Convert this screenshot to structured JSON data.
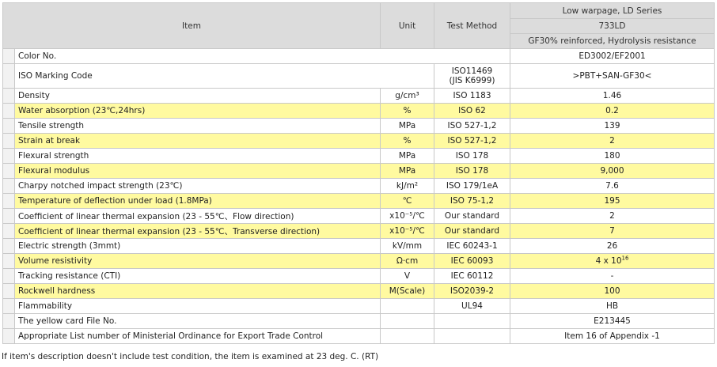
{
  "header": {
    "item": "Item",
    "unit": "Unit",
    "method": "Test Method",
    "series": "Low warpage, LD Series",
    "grade": "733LD",
    "desc": "GF30% reinforced, Hydrolysis resistance"
  },
  "rows": [
    {
      "item": "Color No.",
      "unit": "",
      "method": "",
      "value": "ED3002/EF2001",
      "hl": false,
      "merge": "item"
    },
    {
      "item": "ISO Marking Code",
      "unit": "",
      "method": "ISO11469",
      "method2": "(JIS K6999)",
      "value": ">PBT+SAN-GF30<",
      "hl": false,
      "merge": "unit"
    },
    {
      "item": "Density",
      "unit": "g/cm³",
      "method": "ISO 1183",
      "value": "1.46",
      "hl": false
    },
    {
      "item": "Water absorption (23℃,24hrs)",
      "unit": "%",
      "method": "ISO 62",
      "value": "0.2",
      "hl": true
    },
    {
      "item": "Tensile strength",
      "unit": "MPa",
      "method": "ISO 527-1,2",
      "value": "139",
      "hl": false
    },
    {
      "item": "Strain at break",
      "unit": "%",
      "method": "ISO 527-1,2",
      "value": "2",
      "hl": true
    },
    {
      "item": "Flexural strength",
      "unit": "MPa",
      "method": "ISO 178",
      "value": "180",
      "hl": false
    },
    {
      "item": "Flexural modulus",
      "unit": "MPa",
      "method": "ISO 178",
      "value": "9,000",
      "hl": true
    },
    {
      "item": "Charpy notched impact strength (23℃)",
      "unit": "kJ/m²",
      "method": "ISO 179/1eA",
      "value": "7.6",
      "hl": false
    },
    {
      "item": "Temperature of deflection under load (1.8MPa)",
      "unit": "℃",
      "method": "ISO 75-1,2",
      "value": "195",
      "hl": true
    },
    {
      "item": "Coefficient of linear thermal expansion (23 - 55℃、Flow direction)",
      "unit": "x10⁻⁵/℃",
      "method": "Our standard",
      "value": "2",
      "hl": false
    },
    {
      "item": "Coefficient of linear thermal expansion (23 - 55℃、Transverse direction)",
      "unit": "x10⁻⁵/℃",
      "method": "Our standard",
      "value": "7",
      "hl": true
    },
    {
      "item": "Electric strength (3mmt)",
      "unit": "kV/mm",
      "method": "IEC 60243-1",
      "value": "26",
      "hl": false
    },
    {
      "item": "Volume resistivity",
      "unit": "Ω·cm",
      "method": "IEC 60093",
      "value": "4 x 10",
      "sup": "16",
      "hl": true
    },
    {
      "item": "Tracking resistance (CTI)",
      "unit": "V",
      "method": "IEC 60112",
      "value": "-",
      "hl": false
    },
    {
      "item": "Rockwell hardness",
      "unit": "M(Scale)",
      "method": "ISO2039-2",
      "value": "100",
      "hl": true
    },
    {
      "item": "Flammability",
      "unit": "",
      "method": "UL94",
      "value": "HB",
      "hl": false
    },
    {
      "item": "The yellow card File No.",
      "unit": "",
      "method": "",
      "value": "E213445",
      "hl": false
    },
    {
      "item": "Appropriate List number of Ministerial Ordinance for Export Trade Control",
      "unit": "",
      "method": "",
      "value": "Item 16 of Appendix -1",
      "hl": false
    }
  ],
  "footnote": "If item's description doesn't include test condition, the item is examined at 23 deg. C. (RT)"
}
